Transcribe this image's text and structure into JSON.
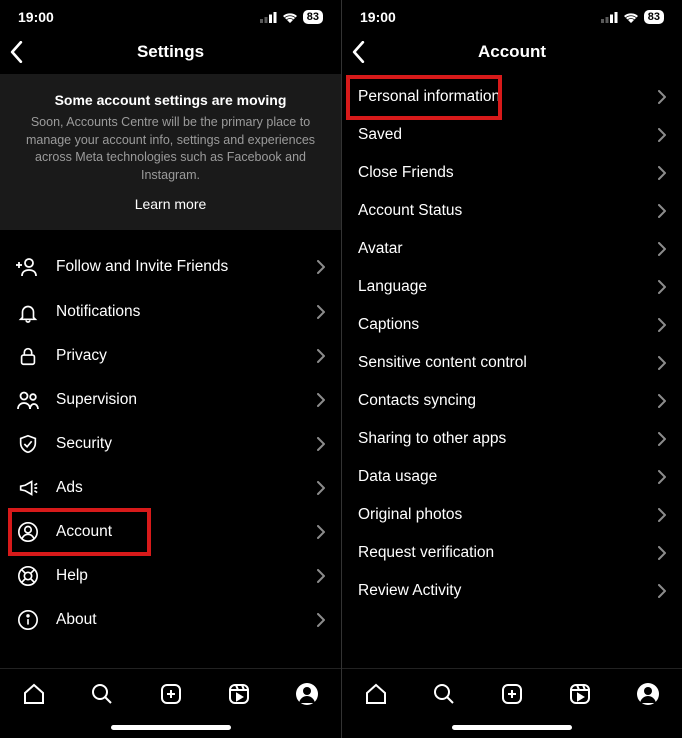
{
  "status": {
    "time": "19:00",
    "battery": "83"
  },
  "left": {
    "title": "Settings",
    "info": {
      "heading": "Some account settings are moving",
      "body": "Soon, Accounts Centre will be the primary place to manage your account info, settings and experiences across Meta technologies such as Facebook and Instagram.",
      "link": "Learn more"
    },
    "items": [
      {
        "label": "Follow and Invite Friends",
        "icon": "add-person-icon"
      },
      {
        "label": "Notifications",
        "icon": "bell-icon"
      },
      {
        "label": "Privacy",
        "icon": "lock-icon"
      },
      {
        "label": "Supervision",
        "icon": "people-icon"
      },
      {
        "label": "Security",
        "icon": "shield-icon"
      },
      {
        "label": "Ads",
        "icon": "megaphone-icon"
      },
      {
        "label": "Account",
        "icon": "account-icon",
        "highlight": true
      },
      {
        "label": "Help",
        "icon": "help-icon"
      },
      {
        "label": "About",
        "icon": "info-icon"
      }
    ]
  },
  "right": {
    "title": "Account",
    "items": [
      {
        "label": "Personal information",
        "highlight": true
      },
      {
        "label": "Saved"
      },
      {
        "label": "Close Friends"
      },
      {
        "label": "Account Status"
      },
      {
        "label": "Avatar"
      },
      {
        "label": "Language"
      },
      {
        "label": "Captions"
      },
      {
        "label": "Sensitive content control"
      },
      {
        "label": "Contacts syncing"
      },
      {
        "label": "Sharing to other apps"
      },
      {
        "label": "Data usage"
      },
      {
        "label": "Original photos"
      },
      {
        "label": "Request verification"
      },
      {
        "label": "Review Activity"
      }
    ]
  }
}
